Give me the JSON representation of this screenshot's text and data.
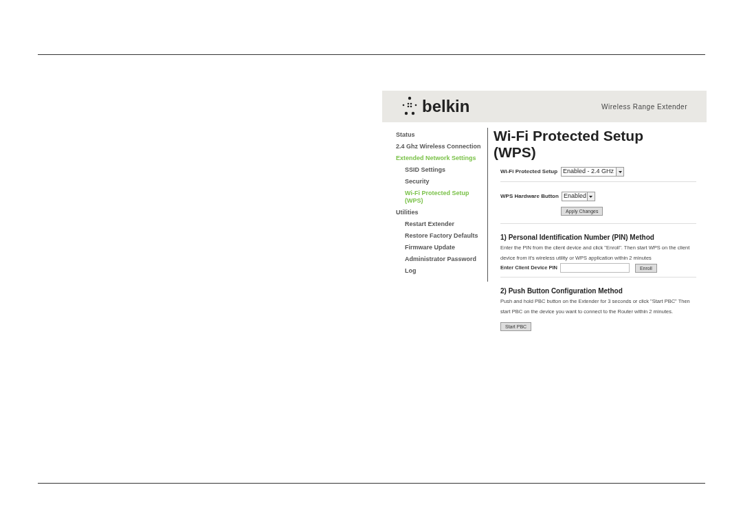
{
  "header": {
    "logo": "belkin",
    "product": "Wireless Range Extender"
  },
  "sidebar": {
    "items": [
      {
        "label": "Status",
        "selected": false
      },
      {
        "label": "2.4 Ghz Wireless Connection",
        "selected": false
      },
      {
        "label": "Extended Network Settings",
        "selected": true,
        "children": [
          {
            "label": "SSID Settings",
            "selected": false
          },
          {
            "label": "Security",
            "selected": false
          },
          {
            "label": "Wi-Fi Protected Setup (WPS)",
            "selected": true
          }
        ]
      },
      {
        "label": "Utilities",
        "selected": false,
        "children": [
          {
            "label": "Restart Extender",
            "selected": false
          },
          {
            "label": "Restore Factory Defaults",
            "selected": false
          },
          {
            "label": "Firmware Update",
            "selected": false
          },
          {
            "label": "Administrator Password",
            "selected": false
          },
          {
            "label": "Log",
            "selected": false
          }
        ]
      }
    ]
  },
  "page_title": "Wi-Fi Protected Setup (WPS)",
  "wps_setting": {
    "label": "Wi-Fi Protected Setup",
    "value": "Enabled - 2.4 GHz"
  },
  "hardware_button": {
    "label": "WPS Hardware Button",
    "value": "Enabled",
    "button": "Apply Changes"
  },
  "pin_method": {
    "heading": "1) Personal Identification Number (PIN) Method",
    "text": "Enter the PIN from the client device and click \"Enroll\". Then start WPS on the client device from it's wireless utility or WPS application within 2 minutes",
    "field_label": "Enter Client Device PIN",
    "button": "Enroll"
  },
  "pbc_method": {
    "heading": "2) Push Button Configuration Method",
    "text": "Push and hold PBC button on the Extender for 3 seconds or click \"Start PBC\" Then start PBC on the device you want to connect to the Router within 2 minutes.",
    "button": "Start PBC"
  }
}
